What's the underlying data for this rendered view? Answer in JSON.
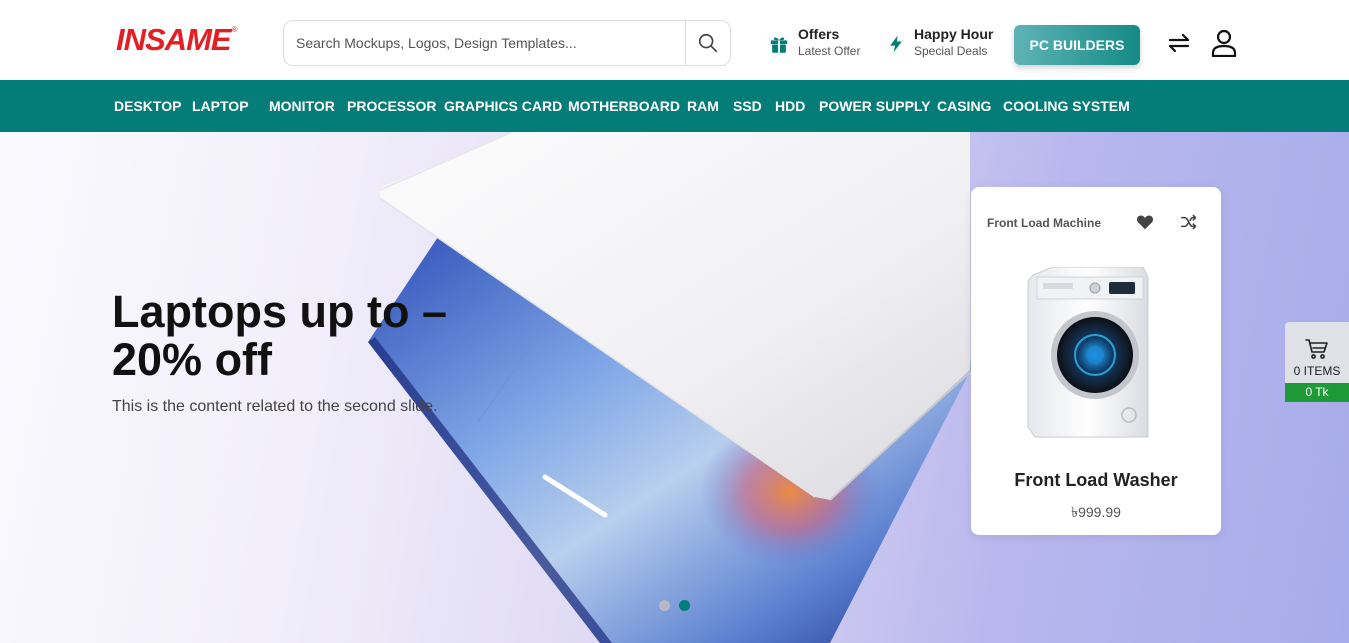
{
  "brand": {
    "logo_text": "INSAME",
    "logo_reg": "®"
  },
  "search": {
    "placeholder": "Search Mockups, Logos, Design Templates..."
  },
  "promos": {
    "offers": {
      "title": "Offers",
      "subtitle": "Latest Offer"
    },
    "happy_hour": {
      "title": "Happy Hour",
      "subtitle": "Special Deals"
    }
  },
  "header": {
    "pc_builders_label": "PC BUILDERS"
  },
  "nav": {
    "items": [
      "DESKTOP",
      "LAPTOP",
      "MONITOR",
      "PROCESSOR",
      "GRAPHICS CARD",
      "MOTHERBOARD",
      "RAM",
      "SSD",
      "HDD",
      "POWER SUPPLY",
      "CASING",
      "COOLING SYSTEM"
    ]
  },
  "hero": {
    "title": "Laptops up to – 20% off",
    "subtitle": "This is the content related to the second slide.",
    "slides_total": 2,
    "active_slide": 2
  },
  "product_card": {
    "category": "Front Load Machine",
    "name": "Front Load Washer",
    "price": "৳999.99"
  },
  "cart": {
    "items_label": "0 ITEMS",
    "total_label": "0 Tk"
  },
  "colors": {
    "brand_red": "#e31e24",
    "teal": "#047c78",
    "cart_green": "#1e9b38"
  }
}
